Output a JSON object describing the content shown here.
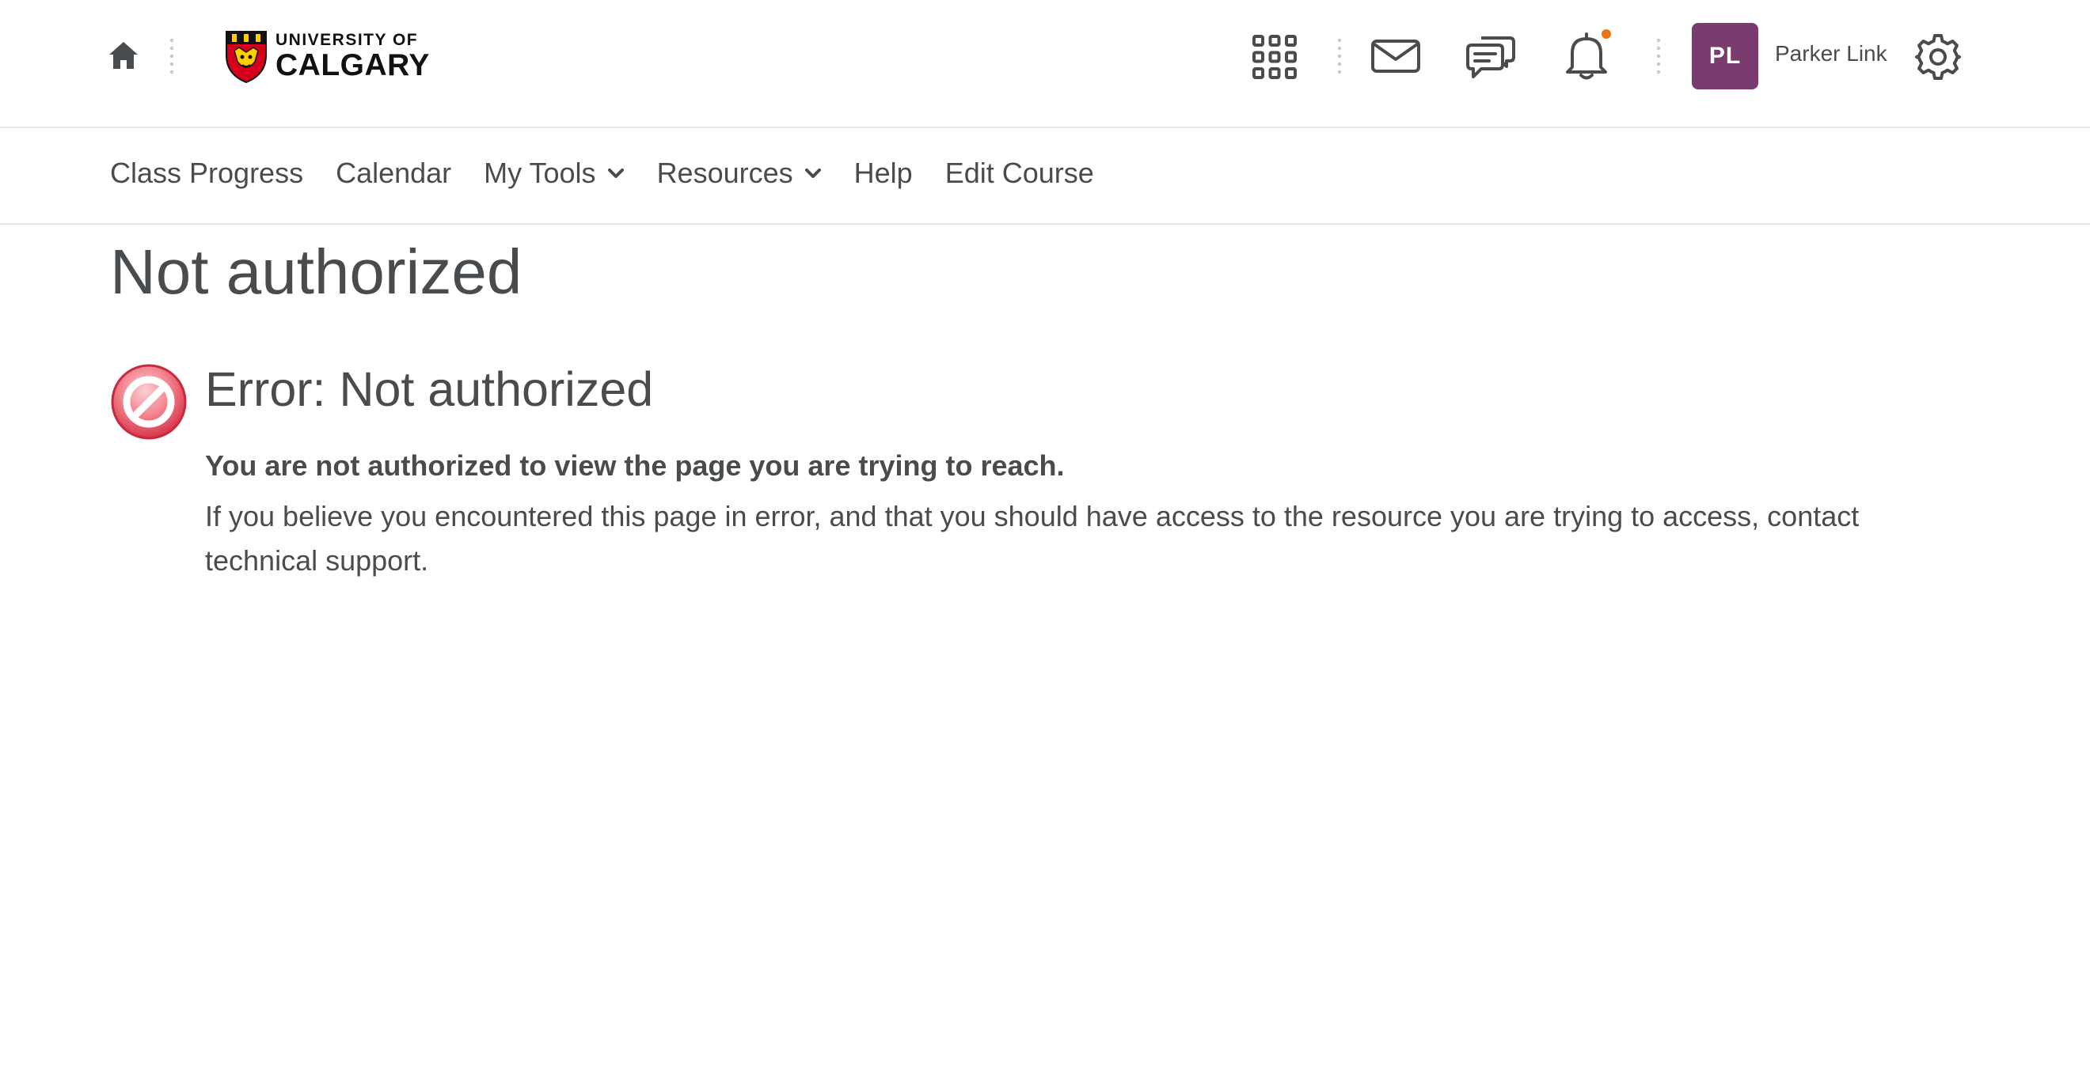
{
  "header": {
    "logo": {
      "line1": "UNIVERSITY OF",
      "line2": "CALGARY",
      "icon": "university-crest-icon"
    },
    "icons": {
      "home": "home-icon",
      "apps": "grid-icon",
      "mail": "envelope-icon",
      "chat": "chat-bubbles-icon",
      "notifications": "bell-icon",
      "settings": "gear-icon"
    },
    "notification_dot_color": "#e87511",
    "user": {
      "initials": "PL",
      "name": "Parker Link",
      "avatar_color": "#7a3c6e"
    }
  },
  "nav": {
    "items": [
      {
        "label": "Class Progress",
        "has_dropdown": false
      },
      {
        "label": "Calendar",
        "has_dropdown": false
      },
      {
        "label": "My Tools",
        "has_dropdown": true
      },
      {
        "label": "Resources",
        "has_dropdown": true
      },
      {
        "label": "Help",
        "has_dropdown": false
      },
      {
        "label": "Edit Course",
        "has_dropdown": false
      }
    ]
  },
  "main": {
    "title": "Not authorized",
    "error": {
      "icon": "no-entry-icon",
      "heading": "Error: Not authorized",
      "message_bold": "You are not authorized to view the page you are trying to reach.",
      "message": "If you believe you encountered this page in error, and that you should have access to the resource you are trying to access, contact technical support."
    }
  }
}
